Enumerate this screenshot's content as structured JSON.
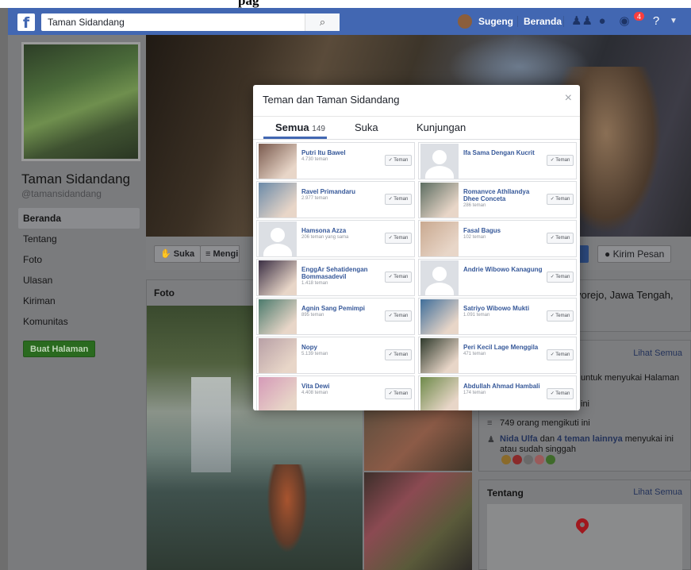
{
  "header": {
    "logo": "f",
    "search_value": "Taman Sidandang",
    "search_icon": "search-icon",
    "user_name": "Sugeng",
    "home_label": "Beranda",
    "notification_count": "4",
    "icons": [
      "friends-icon",
      "messenger-icon",
      "notifications-icon",
      "help-icon",
      "caret-down-icon"
    ]
  },
  "caption": "pag",
  "sidebar": {
    "page_name": "Taman Sidandang",
    "handle": "@tamansidandang",
    "nav": [
      "Beranda",
      "Tentang",
      "Foto",
      "Ulasan",
      "Kiriman",
      "Komunitas"
    ],
    "create_button": "Buat Halaman"
  },
  "actions": {
    "like": "Suka",
    "follow": "Mengikuti",
    "message": "Kirim Pesan"
  },
  "photos": {
    "title": "Foto"
  },
  "location": {
    "text": "vorejo, Jawa Tengah,"
  },
  "community": {
    "see_all": "Lihat Semua",
    "line1": "untuk menyukai Halaman",
    "line2": "ini",
    "followers": "749 orang mengikuti ini",
    "friends_name": "Nida Ulfa",
    "friends_mid": " dan ",
    "friends_others": "4 teman lainnya",
    "friends_tail": " menyukai ini atau sudah singgah"
  },
  "about": {
    "title": "Tentang",
    "see_all": "Lihat Semua"
  },
  "modal": {
    "title": "Teman dan Taman Sidandang",
    "close": "×",
    "tabs": [
      {
        "label": "Semua",
        "count": "149"
      },
      {
        "label": "Suka",
        "count": ""
      },
      {
        "label": "Kunjungan",
        "count": ""
      }
    ],
    "friend_button": "✓ Teman",
    "friends": [
      {
        "name": "Putri Itu Bawel",
        "sub": "4.730 teman",
        "silhouette": false,
        "color": "#7a5a4e"
      },
      {
        "name": "Ifa Sama Dengan Kucrit",
        "sub": "",
        "silhouette": true,
        "color": "#dcdfe4"
      },
      {
        "name": "Ravel Primandaru",
        "sub": "2.977 teman",
        "silhouette": false,
        "color": "#6b8aa8"
      },
      {
        "name": "Romanvce Athllandya Dhee Conceta",
        "sub": "286 teman",
        "silhouette": false,
        "color": "#5d6e62"
      },
      {
        "name": "Hamsona Azza",
        "sub": "206 teman yang sama",
        "silhouette": true,
        "color": "#dcdfe4"
      },
      {
        "name": "Fasal Bagus",
        "sub": "102 teman",
        "silhouette": false,
        "color": "#c9a990"
      },
      {
        "name": "EnggAr Sehatidengan Bommasadevil",
        "sub": "1.418 teman",
        "silhouette": false,
        "color": "#3b2f44"
      },
      {
        "name": "Andrie Wibowo Kanagung",
        "sub": "",
        "silhouette": true,
        "color": "#dcdfe4"
      },
      {
        "name": "Agnin Sang Pemimpi",
        "sub": "895 teman",
        "silhouette": false,
        "color": "#4b7a6c"
      },
      {
        "name": "Satriyo Wibowo Mukti",
        "sub": "1.091 teman",
        "silhouette": false,
        "color": "#3f6e9a"
      },
      {
        "name": "Nopy",
        "sub": "5.139 teman",
        "silhouette": false,
        "color": "#b8a0a6"
      },
      {
        "name": "Peri Kecil Lage Menggila",
        "sub": "471 teman",
        "silhouette": false,
        "color": "#2f3a2c"
      },
      {
        "name": "Vita Dewi",
        "sub": "4.408 teman",
        "silhouette": false,
        "color": "#d59ab8"
      },
      {
        "name": "Abdullah Ahmad Hambali",
        "sub": "174 teman",
        "silhouette": false,
        "color": "#6e8a4a"
      }
    ]
  }
}
